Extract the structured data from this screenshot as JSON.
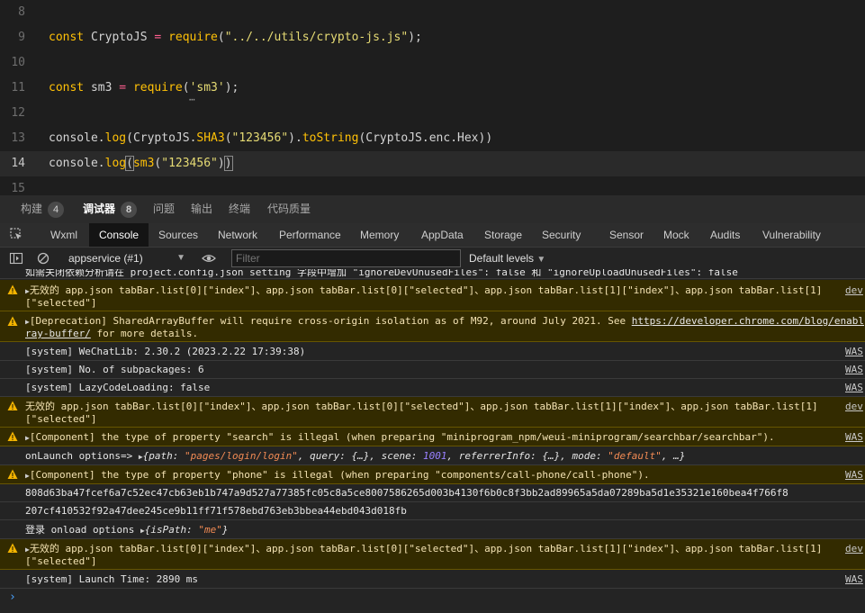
{
  "editor": {
    "lines": [
      {
        "num": "8",
        "code": ""
      },
      {
        "num": "9",
        "code": "const CryptoJS = require(\"../../utils/crypto-js.js\");"
      },
      {
        "num": "10",
        "code": ""
      },
      {
        "num": "11",
        "code": "const sm3 = require('sm3');"
      },
      {
        "num": "12",
        "code": ""
      },
      {
        "num": "13",
        "code": "console.log(CryptoJS.SHA3(\"123456\").toString(CryptoJS.enc.Hex))"
      },
      {
        "num": "14",
        "code": "console.log(sm3(\"123456\"))"
      },
      {
        "num": "15",
        "code": ""
      }
    ],
    "hover_dots": "⋯"
  },
  "panel_tabs": [
    {
      "label": "构建",
      "badge": "4"
    },
    {
      "label": "调试器",
      "badge": "8"
    },
    {
      "label": "问题",
      "badge": ""
    },
    {
      "label": "输出",
      "badge": ""
    },
    {
      "label": "终端",
      "badge": ""
    },
    {
      "label": "代码质量",
      "badge": ""
    }
  ],
  "devtools_tabs": [
    "Wxml",
    "Console",
    "Sources",
    "Network",
    "Performance",
    "Memory",
    "AppData",
    "Storage",
    "Security",
    "Sensor",
    "Mock",
    "Audits",
    "Vulnerability"
  ],
  "toolbar": {
    "context": "appservice (#1)",
    "filter_placeholder": "Filter",
    "levels": "Default levels"
  },
  "console": {
    "rows": [
      {
        "type": "info",
        "text": "如需关闭依赖分析请在 project.config.json setting 字段中增加 \"ignoreDevUnusedFiles\": false 和 \"ignoreUploadUnusedFiles\": false",
        "src": ""
      },
      {
        "type": "warn",
        "line1": "无效的 app.json tabBar.list[0][\"index\"]、app.json tabBar.list[0][\"selected\"]、app.json tabBar.list[1][\"index\"]、app.json tabBar.list[1]",
        "line2": "[\"selected\"]",
        "src": "dev"
      },
      {
        "type": "warn",
        "line1_prefix": "[Deprecation] SharedArrayBuffer will require cross-origin isolation as of M92, around July 2021. See ",
        "line1_link": "https://developer.chrome.com/blog/enabl",
        "line2_link": "ray-buffer/",
        "line2_suffix": " for more details.",
        "src": ""
      },
      {
        "type": "info",
        "text": "[system] WeChatLib: 2.30.2 (2023.2.22 17:39:38)",
        "src": "WAS"
      },
      {
        "type": "info",
        "text": "[system] No. of subpackages: 6",
        "src": "WAS"
      },
      {
        "type": "info",
        "text": "[system] LazyCodeLoading: false",
        "src": "WAS"
      },
      {
        "type": "warn",
        "line1": "无效的 app.json tabBar.list[0][\"index\"]、app.json tabBar.list[0][\"selected\"]、app.json tabBar.list[1][\"index\"]、app.json tabBar.list[1]",
        "line2": "[\"selected\"]",
        "src": "dev"
      },
      {
        "type": "warn",
        "text": "[Component] the type of property \"search\" is illegal (when preparing \"miniprogram_npm/weui-miniprogram/searchbar/searchbar\").",
        "src": "WAS"
      },
      {
        "type": "info",
        "text": "onLaunch options=> ",
        "obj": "{path: \"pages/login/login\", query: {…}, scene: 1001, referrerInfo: {…}, mode: \"default\", …}",
        "src": ""
      },
      {
        "type": "warn",
        "text": "[Component] the type of property \"phone\" is illegal (when preparing \"components/call-phone/call-phone\").",
        "src": "WAS"
      },
      {
        "type": "info",
        "text": "808d63ba47fcef6a7c52ec47cb63eb1b747a9d527a77385fc05c8a5ce8007586265d003b4130f6b0c8f3bb2ad89965a5da07289ba5d1e35321e160bea4f766f8",
        "src": ""
      },
      {
        "type": "info",
        "text": "207cf410532f92a47dee245ce9b11ff71f578ebd763eb3bbea44ebd043d018fb",
        "src": ""
      },
      {
        "type": "info",
        "text": "登录 onload options ",
        "obj": "{isPath: \"me\"}",
        "src": ""
      },
      {
        "type": "warn",
        "line1": "无效的 app.json tabBar.list[0][\"index\"]、app.json tabBar.list[0][\"selected\"]、app.json tabBar.list[1][\"index\"]、app.json tabBar.list[1]",
        "line2": "[\"selected\"]",
        "src": "dev"
      },
      {
        "type": "info",
        "text": "[system] Launch Time: 2890 ms",
        "src": "WAS"
      }
    ],
    "prompt": "›"
  },
  "colors": {
    "accent": "#ffc107",
    "warn_bg": "#332b00",
    "warn_text": "#f3e2b3",
    "string": "#e6db74"
  }
}
